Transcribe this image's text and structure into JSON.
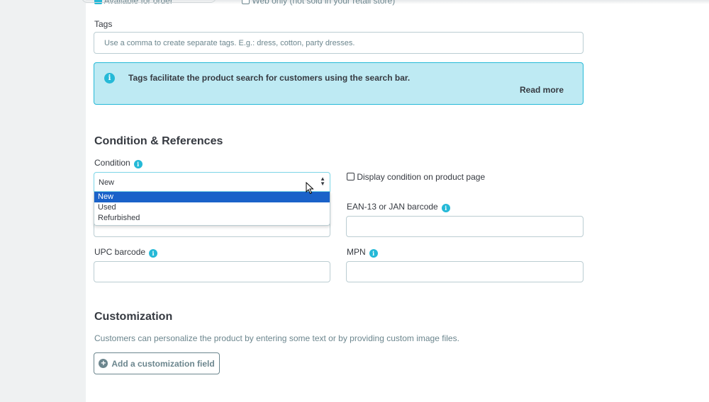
{
  "top_partial": {
    "available_label": "Available for order",
    "web_only_label": "Web only (not sold in your retail store)"
  },
  "tags": {
    "label": "Tags",
    "placeholder": "Use a comma to create separate tags. E.g.: dress, cotton, party dresses."
  },
  "info_box": {
    "text": "Tags facilitate the product search for customers using the search bar.",
    "read_more": "Read more"
  },
  "condition_section": {
    "title": "Condition & References",
    "condition_label": "Condition",
    "selected": "New",
    "options": [
      "New",
      "Used",
      "Refurbished"
    ],
    "display_condition_label": "Display condition on product page",
    "ean_label": "EAN-13 or JAN barcode",
    "upc_label": "UPC barcode",
    "mpn_label": "MPN"
  },
  "customization": {
    "title": "Customization",
    "description": "Customers can personalize the product by entering some text or by providing custom image files.",
    "add_button": "Add a customization field"
  },
  "colors": {
    "accent": "#25b9d7",
    "info_bg": "#beeaf3",
    "selected_option": "#1a62c9"
  },
  "icons": {
    "info": "info-circle-icon",
    "help": "help-icon",
    "add": "plus-circle-icon",
    "cursor": "mouse-cursor-icon"
  }
}
